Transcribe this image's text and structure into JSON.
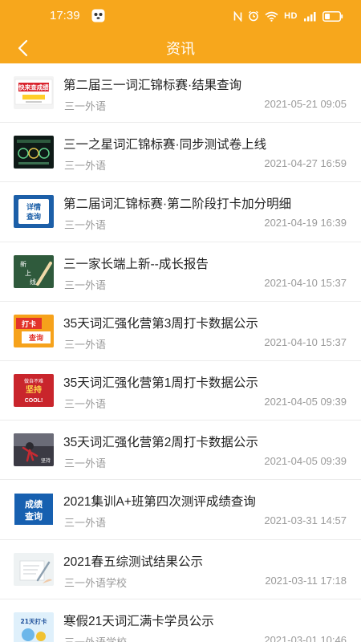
{
  "status_bar": {
    "time": "17:39",
    "network_label": "HD",
    "signal_label": "4G",
    "icons": [
      "panda-app-icon",
      "nfc-icon",
      "alarm-icon",
      "wifi-icon",
      "signal-icon",
      "battery-icon"
    ]
  },
  "header": {
    "title": "资讯",
    "back_icon": "chevron-left-icon"
  },
  "colors": {
    "header_bg": "#f7a71c",
    "title_text": "#222222",
    "meta_text": "#9a9a9a"
  },
  "news": [
    {
      "title": "第二届三一词汇锦标赛·结果查询",
      "source": "三一外语",
      "date": "2021-05-21 09:05",
      "thumb_text": [
        "快来查成绩"
      ]
    },
    {
      "title": "三一之星词汇锦标赛·同步测试卷上线",
      "source": "三一外语",
      "date": "2021-04-27 16:59",
      "thumb_text": []
    },
    {
      "title": "第二届词汇锦标赛·第二阶段打卡加分明细",
      "source": "三一外语",
      "date": "2021-04-19 16:39",
      "thumb_text": [
        "详情",
        "查询"
      ]
    },
    {
      "title": "三一家长端上新--成长报告",
      "source": "三一外语",
      "date": "2021-04-10 15:37",
      "thumb_text": [
        "新",
        "上",
        "线"
      ]
    },
    {
      "title": "35天词汇强化营第3周打卡数据公示",
      "source": "三一外语",
      "date": "2021-04-10 15:37",
      "thumb_text": [
        "打卡",
        "查询"
      ]
    },
    {
      "title": "35天词汇强化营第1周打卡数据公示",
      "source": "三一外语",
      "date": "2021-04-05 09:39",
      "thumb_text": [
        "做自不难",
        "坚持",
        "COOL!"
      ]
    },
    {
      "title": "35天词汇强化营第2周打卡数据公示",
      "source": "三一外语",
      "date": "2021-04-05 09:39",
      "thumb_text": [
        "坚持"
      ]
    },
    {
      "title": "2021集训A+班第四次测评成绩查询",
      "source": "三一外语",
      "date": "2021-03-31 14:57",
      "thumb_text": [
        "成绩",
        "查询"
      ]
    },
    {
      "title": "2021春五综测试结果公示",
      "source": "三一外语学校",
      "date": "2021-03-11 17:18",
      "thumb_text": []
    },
    {
      "title": "寒假21天词汇满卡学员公示",
      "source": "三一外语学校",
      "date": "2021-03-01 10:46",
      "thumb_text": [
        "21天打卡"
      ]
    }
  ]
}
